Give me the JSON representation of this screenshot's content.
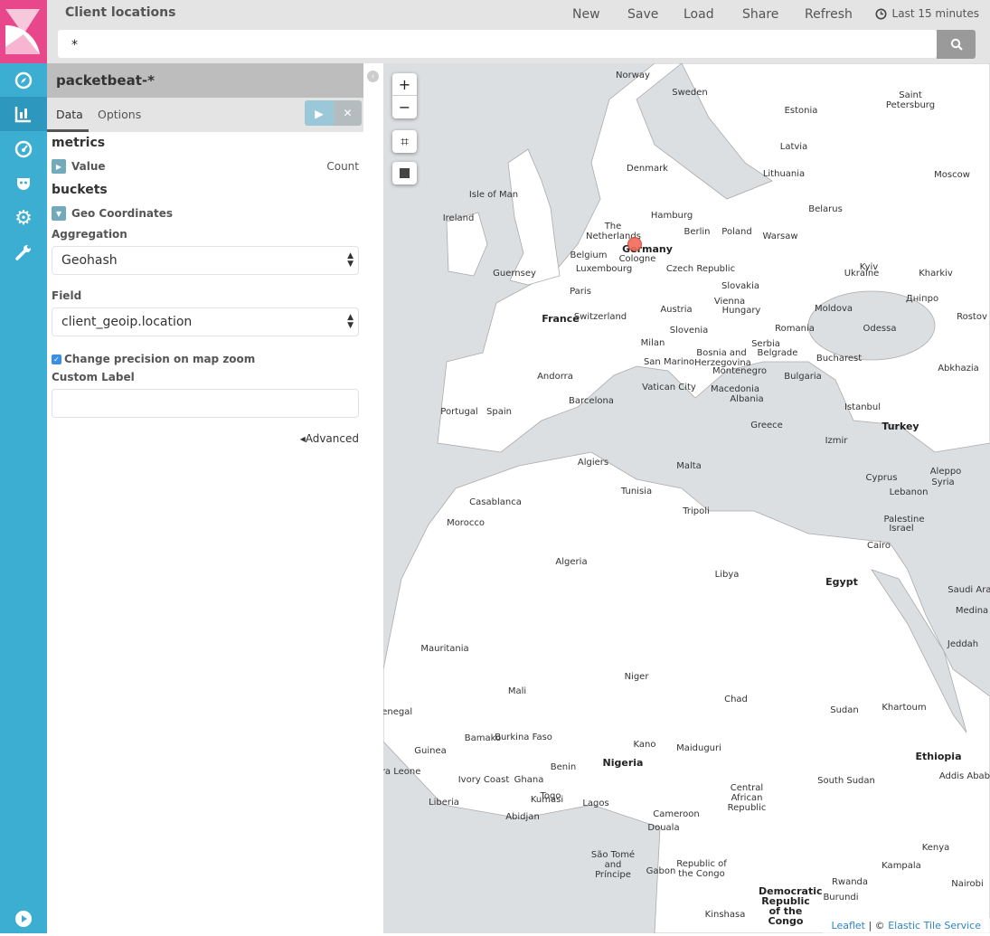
{
  "header": {
    "title": "Client locations",
    "menu": [
      "New",
      "Save",
      "Load",
      "Share",
      "Refresh"
    ],
    "time_range": "Last 15 minutes",
    "query": "*"
  },
  "colors": {
    "nav": "#3caed2",
    "logo": "#e8488b",
    "marker": "#f06a5a",
    "link": "#2b87c6"
  },
  "nav_icons": [
    "compass-icon",
    "bar-chart-icon",
    "dashboard-icon",
    "devtools-icon",
    "gear-icon",
    "wrench-icon",
    "play-icon"
  ],
  "panel": {
    "index_pattern": "packetbeat-*",
    "tabs": [
      "Data",
      "Options"
    ],
    "metrics_title": "metrics",
    "metric_label": "Value",
    "metric_value": "Count",
    "buckets_title": "buckets",
    "bucket_label": "Geo Coordinates",
    "aggregation_label": "Aggregation",
    "aggregation_value": "Geohash",
    "field_label": "Field",
    "field_value": "client_geoip.location",
    "precision_label": "Change precision on map zoom",
    "precision_checked": true,
    "custom_label": "Custom Label",
    "custom_value": "",
    "advanced": "Advanced"
  },
  "map": {
    "zoom_in": "+",
    "zoom_out": "−",
    "attribution_leaflet": "Leaflet",
    "attribution_sep": "| ©",
    "attribution_tiles": "Elastic Tile Service",
    "labels": [
      "Norway",
      "Sweden",
      "Saint Petersburg",
      "Estonia",
      "Latvia",
      "Denmark",
      "Lithuania",
      "Moscow",
      "Isle of Man",
      "Ireland",
      "Hamburg",
      "Belarus",
      "The Netherlands",
      "Berlin",
      "Poland",
      "Warsaw",
      "Belgium",
      "Germany",
      "Cologne",
      "Luxembourg",
      "Czech Republic",
      "Kyiv",
      "Ukraine",
      "Kharkiv",
      "Guernsey",
      "Paris",
      "Slovakia",
      "Дніпро",
      "Rostov",
      "Austria",
      "Moldova",
      "France",
      "Switzerland",
      "Hungary",
      "Vienna",
      "Slovenia",
      "Romania",
      "Odessa",
      "Milan",
      "Bosnia and Herzegovina",
      "Serbia",
      "San Marino",
      "Belgrade",
      "Bucharest",
      "Montenegro",
      "Abkhazia",
      "Andorra",
      "Vatican City",
      "Macedonia",
      "Bulgaria",
      "Barcelona",
      "Albania",
      "Portugal",
      "Spain",
      "Istanbul",
      "Turkey",
      "Greece",
      "Izmir",
      "Algiers",
      "Malta",
      "Cyprus",
      "Aleppo",
      "Syria",
      "Tunisia",
      "Lebanon",
      "Casablanca",
      "Tripoli",
      "Palestine",
      "Israel",
      "Morocco",
      "Cairo",
      "Algeria",
      "Libya",
      "Egypt",
      "Saudi Arabia",
      "Medina",
      "Jeddah",
      "Mauritania",
      "Niger",
      "Mali",
      "Chad",
      "Sudan",
      "Khartoum",
      "Senegal",
      "Bamako",
      "Burkina Faso",
      "Kano",
      "Maiduguri",
      "Ethiopia",
      "Guinea",
      "Benin",
      "Nigeria",
      "Addis Ababa",
      "Sierra Leone",
      "Ivory Coast",
      "Ghana",
      "Togo",
      "Central African Republic",
      "South Sudan",
      "Liberia",
      "Kumasi",
      "Lagos",
      "Cameroon",
      "Abidjan",
      "Douala",
      "São Tomé and Príncipe",
      "Gabon",
      "Republic of the Congo",
      "Democratic Republic of the Congo",
      "Kenya",
      "Kampala",
      "Rwanda",
      "Nairobi",
      "Kinshasa",
      "Burundi"
    ],
    "bold_labels": [
      "Germany",
      "France",
      "Turkey",
      "Egypt",
      "Nigeria",
      "Ethiopia",
      "Democratic Republic of the Congo"
    ]
  }
}
